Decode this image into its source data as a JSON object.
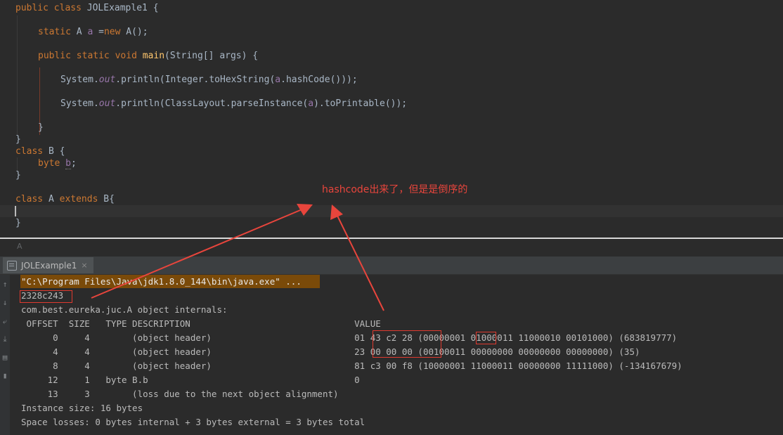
{
  "editor": {
    "line1": {
      "kw1": "public",
      "kw2": "class",
      "name": "JOLExample1",
      "brace": "{"
    },
    "line2": {
      "kw": "static",
      "type": "A",
      "var": "a",
      "eq": "=",
      "new": "new",
      "call": "A();"
    },
    "line3": {
      "kw1": "public",
      "kw2": "static",
      "kw3": "void",
      "method": "main",
      "open": "(",
      "param_type": "String",
      "rest": "[] args) {"
    },
    "line4": {
      "sys": "System.",
      "out": "out",
      "mid": ".println(",
      "cls": "Integer",
      "dot": ".",
      "fn": "toHexString",
      "p1": "(",
      "obj": "a",
      "dot2": ".",
      "hash": "hashCode",
      "end": "()));"
    },
    "line5": {
      "sys": "System.",
      "out": "out",
      "mid": ".println(",
      "cls": "ClassLayout",
      "dot": ".",
      "fn": "parseInstance",
      "p1": "(",
      "obj": "a",
      "p2": ").",
      "fn2": "toPrintable",
      "end": "());"
    },
    "line6": "}",
    "line7": "}",
    "line8": {
      "kw": "class",
      "name": "B",
      "brace": "{"
    },
    "line9": {
      "type": "byte",
      "var": "b",
      "semi": ";"
    },
    "line10": "}",
    "line11": {
      "kw": "class",
      "name": "A",
      "ext": "extends",
      "base": "B",
      "brace": "{"
    },
    "line12": "}"
  },
  "breadcrumb": "A",
  "run_tab": {
    "label": "JOLExample1",
    "close": "×"
  },
  "console": {
    "cmd": "\"C:\\Program Files\\Java\\jdk1.8.0_144\\bin\\java.exe\" ...",
    "hash": "2328c243",
    "internals": "com.best.eureka.juc.A object internals:",
    "header": " OFFSET  SIZE   TYPE DESCRIPTION                               VALUE",
    "rows": [
      "      0     4        (object header)                           01 43 c2 28 (00000001 01000011 11000010 00101000) (683819777)",
      "      4     4        (object header)                           23 00 00 00 (00100011 00000000 00000000 00000000) (35)",
      "      8     4        (object header)                           81 c3 00 f8 (10000001 11000011 00000000 11111000) (-134167679)",
      "     12     1   byte B.b                                       0",
      "     13     3        (loss due to the next object alignment)"
    ],
    "instance_size": "Instance size: 16 bytes",
    "space_losses": "Space losses: 0 bytes internal + 3 bytes external = 3 bytes total"
  },
  "annotation": "hashcode出来了，但是是倒序的",
  "colors": {
    "annotation": "#e8453c",
    "box": "#e03a2f",
    "cmd_bg": "#7a4a09"
  },
  "gutter_icons": [
    "up-arrow-icon",
    "down-arrow-icon",
    "wrap-icon",
    "scroll-end-icon",
    "print-icon",
    "trash-icon"
  ]
}
